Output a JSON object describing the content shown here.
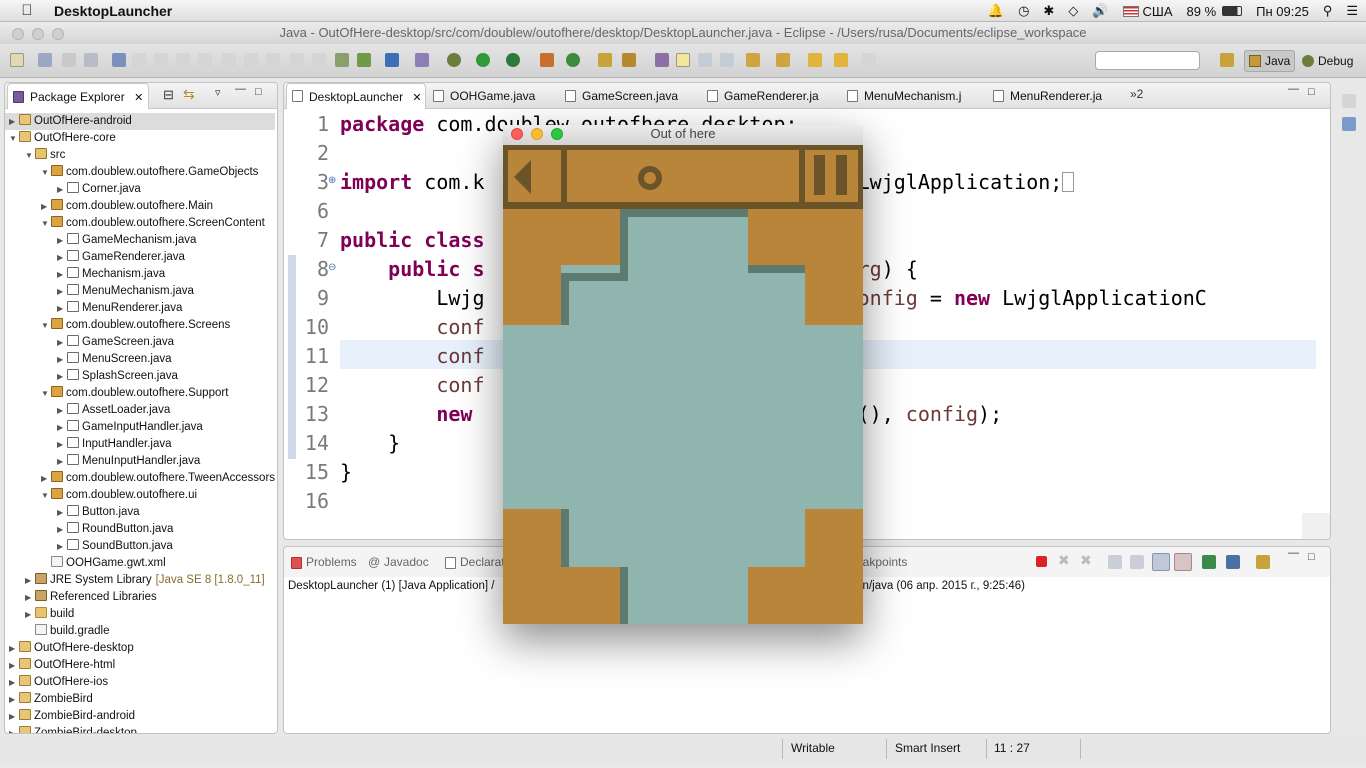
{
  "menubar": {
    "app_name": "DesktopLauncher",
    "keyboard_layout": "США",
    "battery": "89 %",
    "clock": "Пн 09:25"
  },
  "window_title": "Java - OutOfHere-desktop/src/com/doublew/outofhere/desktop/DesktopLauncher.java - Eclipse - /Users/rusa/Documents/eclipse_workspace",
  "toolbar": {
    "quick_access_placeholder": "",
    "perspective_java": "Java",
    "perspective_debug": "Debug"
  },
  "package_explorer": {
    "tab_label": "Package Explorer",
    "items": [
      {
        "label": "OutOfHere-android",
        "extra": ""
      },
      {
        "label": "OutOfHere-core",
        "extra": ""
      },
      {
        "label": "src",
        "extra": ""
      },
      {
        "label": "com.doublew.outofhere.GameObjects",
        "extra": ""
      },
      {
        "label": "Corner.java",
        "extra": ""
      },
      {
        "label": "com.doublew.outofhere.Main",
        "extra": ""
      },
      {
        "label": "com.doublew.outofhere.ScreenContent",
        "extra": ""
      },
      {
        "label": "GameMechanism.java",
        "extra": ""
      },
      {
        "label": "GameRenderer.java",
        "extra": ""
      },
      {
        "label": "Mechanism.java",
        "extra": ""
      },
      {
        "label": "MenuMechanism.java",
        "extra": ""
      },
      {
        "label": "MenuRenderer.java",
        "extra": ""
      },
      {
        "label": "com.doublew.outofhere.Screens",
        "extra": ""
      },
      {
        "label": "GameScreen.java",
        "extra": ""
      },
      {
        "label": "MenuScreen.java",
        "extra": ""
      },
      {
        "label": "SplashScreen.java",
        "extra": ""
      },
      {
        "label": "com.doublew.outofhere.Support",
        "extra": ""
      },
      {
        "label": "AssetLoader.java",
        "extra": ""
      },
      {
        "label": "GameInputHandler.java",
        "extra": ""
      },
      {
        "label": "InputHandler.java",
        "extra": ""
      },
      {
        "label": "MenuInputHandler.java",
        "extra": ""
      },
      {
        "label": "com.doublew.outofhere.TweenAccessors",
        "extra": ""
      },
      {
        "label": "com.doublew.outofhere.ui",
        "extra": ""
      },
      {
        "label": "Button.java",
        "extra": ""
      },
      {
        "label": "RoundButton.java",
        "extra": ""
      },
      {
        "label": "SoundButton.java",
        "extra": ""
      },
      {
        "label": "OOHGame.gwt.xml",
        "extra": ""
      },
      {
        "label": "JRE System Library",
        "extra": "[Java SE 8 [1.8.0_11]"
      },
      {
        "label": "Referenced Libraries",
        "extra": ""
      },
      {
        "label": "build",
        "extra": ""
      },
      {
        "label": "build.gradle",
        "extra": ""
      },
      {
        "label": "OutOfHere-desktop",
        "extra": ""
      },
      {
        "label": "OutOfHere-html",
        "extra": ""
      },
      {
        "label": "OutOfHere-ios",
        "extra": ""
      },
      {
        "label": "ZombieBird",
        "extra": ""
      },
      {
        "label": "ZombieBird-android",
        "extra": ""
      },
      {
        "label": "ZombieBird-desktop",
        "extra": ""
      }
    ]
  },
  "editor_tabs": [
    {
      "label": "DesktopLauncher"
    },
    {
      "label": "OOHGame.java"
    },
    {
      "label": "GameScreen.java"
    },
    {
      "label": "GameRenderer.ja"
    },
    {
      "label": "MenuMechanism.j"
    },
    {
      "label": "MenuRenderer.ja"
    }
  ],
  "editor_overflow": "»2",
  "code_lines": [
    "1",
    "2",
    "3",
    "6",
    "7",
    "8",
    "9",
    "10",
    "11",
    "12",
    "13",
    "14",
    "15",
    "16"
  ],
  "code": {
    "l1_kw": "package",
    "l1_rest": " com.doublew.outofhere.desktop;",
    "l3_kw": "import",
    "l3_a": " com.k",
    "l3_b": "gl.LwjglApplication;",
    "l7_kw": "public class",
    "l8_kw": "public s",
    "l8_var": "] arg",
    "l8_rest": ") {",
    "l9_a": "Lwjg",
    "l9_var": "n config",
    "l9_eq": " = ",
    "l9_kw": "new",
    "l9_rest": " LwjglApplicationC",
    "l10": "conf",
    "l10_end": ";",
    "l11": "conf",
    "l12": "conf",
    "l13_kw": "new",
    "l13_a": "Game(), ",
    "l13_var": "config",
    "l13_end": ");",
    "l14": "}",
    "l15": "}"
  },
  "console": {
    "tabs": [
      "Problems",
      "Javadoc",
      "Declarat",
      "eakpoints"
    ],
    "launch_left": "DesktopLauncher (1) [Java Application] /",
    "launch_right": "in/java (06 апр. 2015 г., 9:25:46)"
  },
  "game_window": {
    "title": "Out of here"
  },
  "statusbar": {
    "writable": "Writable",
    "insert_mode": "Smart Insert",
    "position": "11 : 27"
  },
  "colors": {
    "game_block": "#b8853a",
    "game_bg": "#8fb5ae",
    "game_shadow": "#5c7a6f",
    "keyword": "#7f0055"
  }
}
